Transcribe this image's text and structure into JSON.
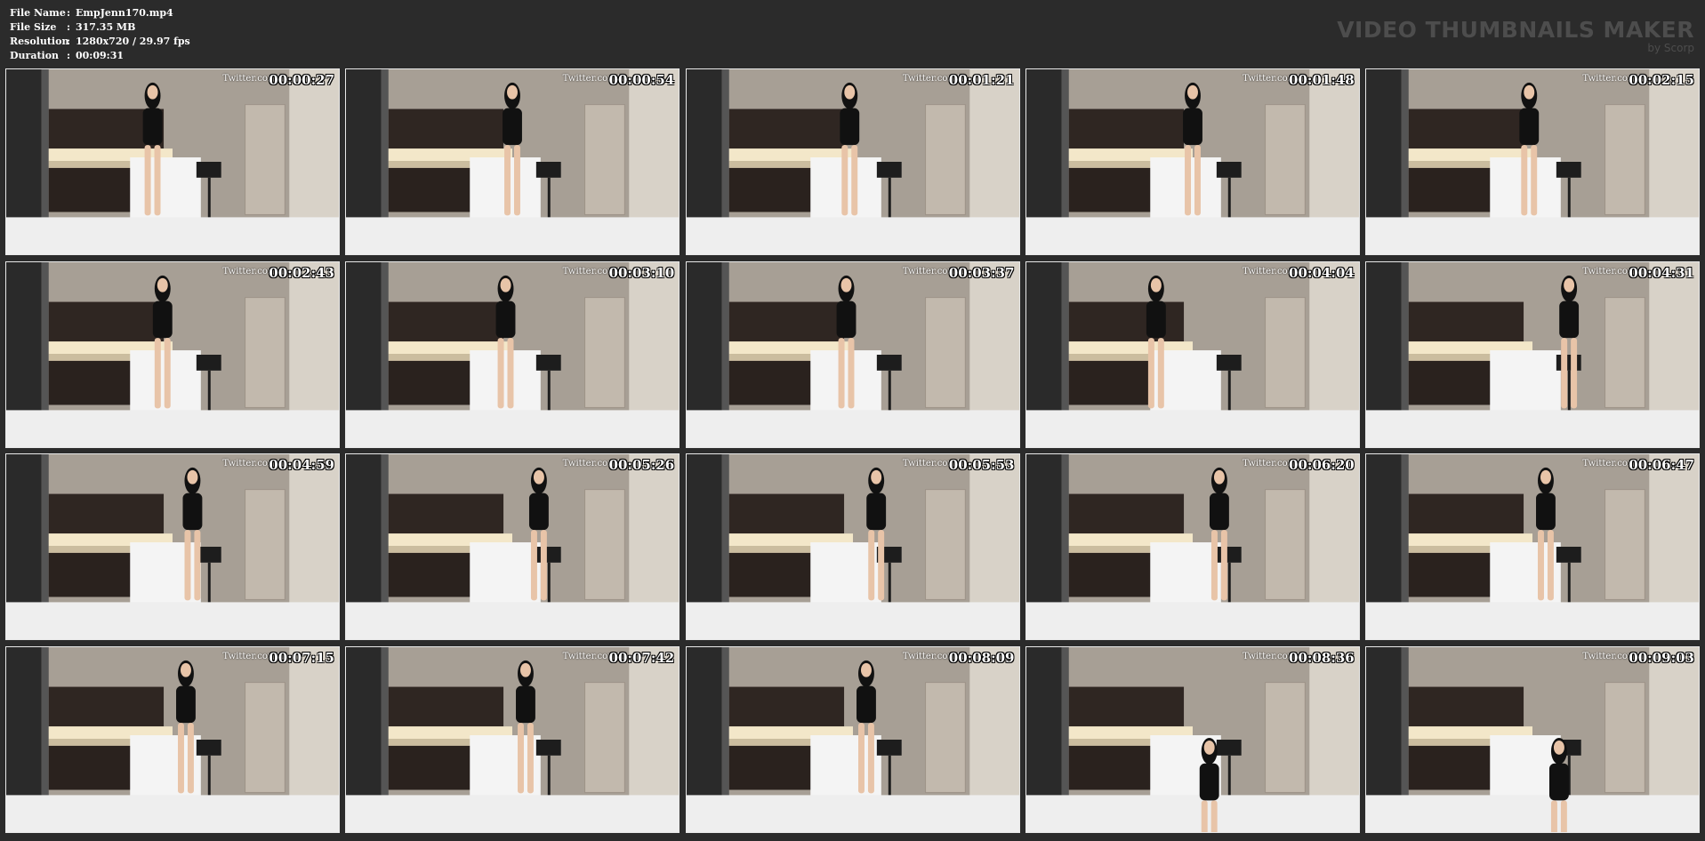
{
  "info": {
    "rows": [
      {
        "label": "File Name",
        "sep": ":",
        "value": "EmpJenn170.mp4"
      },
      {
        "label": "File Size",
        "sep": ":",
        "value": "317.35 MB"
      },
      {
        "label": "Resolution",
        "sep": ":",
        "value": "1280x720 / 29.97 fps"
      },
      {
        "label": "Duration",
        "sep": ":",
        "value": "00:09:31"
      }
    ]
  },
  "brand": {
    "title": "VIDEO THUMBNAILS MAKER",
    "subtitle": "by Scorp"
  },
  "watermark_text": "Twitter.com/E",
  "thumbnails": [
    {
      "timestamp": "00:00:27",
      "watermark": "Twitter.com/E"
    },
    {
      "timestamp": "00:00:54",
      "watermark": "Twitter.com/E"
    },
    {
      "timestamp": "00:01:21",
      "watermark": "Twitter.com/E"
    },
    {
      "timestamp": "00:01:48",
      "watermark": "Twitter.com/E"
    },
    {
      "timestamp": "00:02:15",
      "watermark": "Twitter.com/E"
    },
    {
      "timestamp": "00:02:43",
      "watermark": "Twitter.com/E"
    },
    {
      "timestamp": "00:03:10",
      "watermark": "Twitter.com/E"
    },
    {
      "timestamp": "00:03:37",
      "watermark": "Twitter.com/E"
    },
    {
      "timestamp": "00:04:04",
      "watermark": "Twitter.com/E"
    },
    {
      "timestamp": "00:04:31",
      "watermark": "Twitter.com/E"
    },
    {
      "timestamp": "00:04:59",
      "watermark": "Twitter.com/E"
    },
    {
      "timestamp": "00:05:26",
      "watermark": "Twitter.com/E"
    },
    {
      "timestamp": "00:05:53",
      "watermark": "Twitter.com/E"
    },
    {
      "timestamp": "00:06:20",
      "watermark": "Twitter.com/E"
    },
    {
      "timestamp": "00:06:47",
      "watermark": "Twitter.com/E"
    },
    {
      "timestamp": "00:07:15",
      "watermark": "Twitter.com/E"
    },
    {
      "timestamp": "00:07:42",
      "watermark": "Twitter.com/E"
    },
    {
      "timestamp": "00:08:09",
      "watermark": "Twitter.com/E"
    },
    {
      "timestamp": "00:08:36",
      "watermark": "Twitter.com/E"
    },
    {
      "timestamp": "00:09:03",
      "watermark": "Twitter.com/E"
    }
  ],
  "colors": {
    "background": "#2b2b2b",
    "text": "#ffffff",
    "brand": "#4d4d4d"
  }
}
